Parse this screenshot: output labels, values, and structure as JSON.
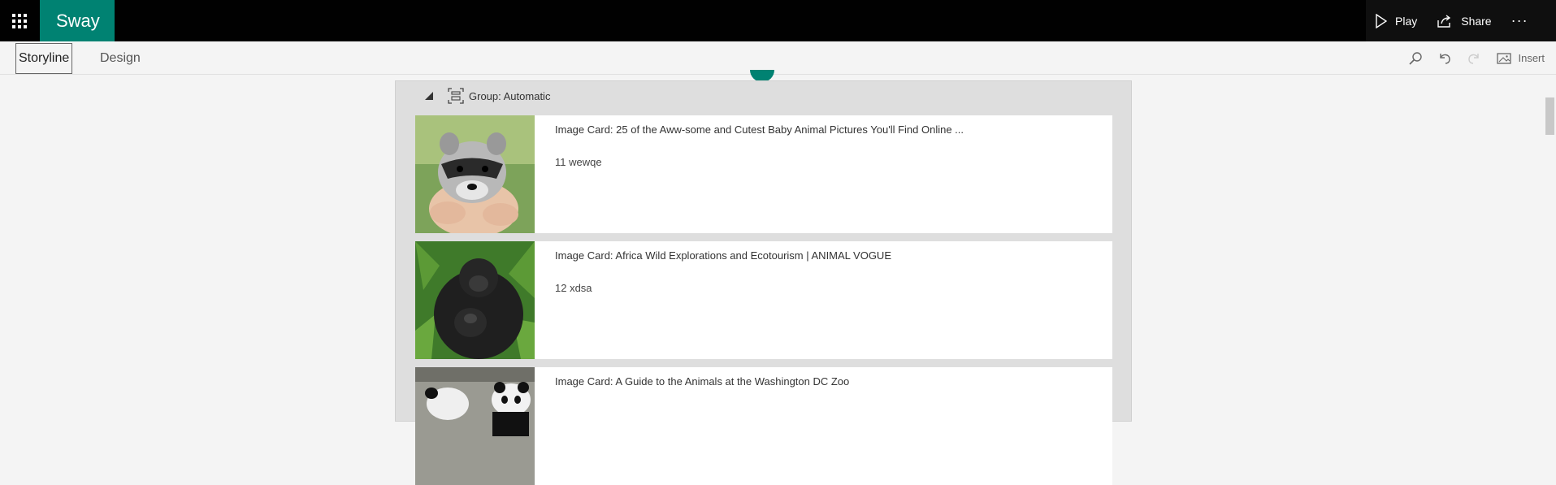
{
  "app": {
    "name": "Sway"
  },
  "topbar": {
    "play_label": "Play",
    "share_label": "Share",
    "more_label": "···",
    "waffle_icon": "app-launcher-icon"
  },
  "toolbar": {
    "tabs": [
      {
        "label": "Storyline",
        "active": true
      },
      {
        "label": "Design",
        "active": false
      }
    ],
    "insert_label": "Insert",
    "icons": [
      "search-icon",
      "undo-icon",
      "redo-icon",
      "image-icon"
    ]
  },
  "group": {
    "label": "Group: Automatic"
  },
  "cards": [
    {
      "title": "Image Card: 25 of the Aww-some and Cutest Baby Animal Pictures You'll Find Online ...",
      "caption": "11 wewqe",
      "image": "raccoon-photo"
    },
    {
      "title": "Image Card: Africa Wild Explorations and Ecotourism | ANIMAL VOGUE",
      "caption": "12  xdsa",
      "image": "gorilla-photo"
    },
    {
      "title": "Image Card: A Guide to the Animals at the Washington DC Zoo",
      "caption": "",
      "image": "panda-photo"
    }
  ],
  "colors": {
    "brand": "#008272",
    "topbar": "#010101",
    "group_bg": "#dedede"
  }
}
